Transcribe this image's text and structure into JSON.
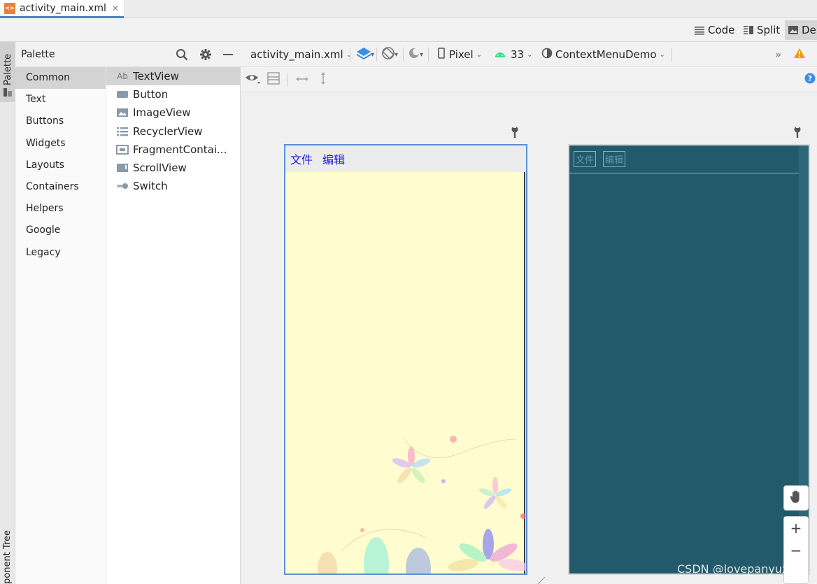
{
  "file_tab": {
    "icon": "xml-file-icon",
    "name": "activity_main.xml",
    "close": "✕"
  },
  "view_modes": [
    {
      "label": "Code",
      "icon": "code-lines-icon"
    },
    {
      "label": "Split",
      "icon": "split-view-icon"
    },
    {
      "label": "De",
      "icon": "design-image-icon"
    }
  ],
  "side_tabs": {
    "palette": "Palette",
    "component_tree": "ponent Tree"
  },
  "palette": {
    "title": "Palette",
    "categories": [
      "Common",
      "Text",
      "Buttons",
      "Widgets",
      "Layouts",
      "Containers",
      "Helpers",
      "Google",
      "Legacy"
    ],
    "selected_category": "Common",
    "widgets": [
      {
        "label": "TextView",
        "icon": "textview-ab-icon",
        "ab": "Ab"
      },
      {
        "label": "Button",
        "icon": "button-icon"
      },
      {
        "label": "ImageView",
        "icon": "image-icon"
      },
      {
        "label": "RecyclerView",
        "icon": "list-icon"
      },
      {
        "label": "FragmentContai...",
        "icon": "fragment-icon"
      },
      {
        "label": "ScrollView",
        "icon": "scrollview-icon"
      },
      {
        "label": "Switch",
        "icon": "switch-icon"
      }
    ]
  },
  "toolbar": {
    "file": "activity_main.xml",
    "device": "Pixel",
    "api": "33",
    "theme": "ContextMenuDemo",
    "overflow": "»"
  },
  "design_preview": {
    "menu_items": [
      "文件",
      "编辑"
    ]
  },
  "blueprint_preview": {
    "menu_items": [
      "文件",
      "编辑"
    ]
  },
  "zoom": {
    "plus": "+",
    "minus": "−"
  },
  "watermark": "CSDN @lovepanyuxiao",
  "colors": {
    "accent": "#4a86c8",
    "blueprint": "#235a6b",
    "design_bg": "#fffdd0",
    "menu_text": "#1a1ad8",
    "warning": "#e8a000",
    "help": "#3a8ee6"
  }
}
